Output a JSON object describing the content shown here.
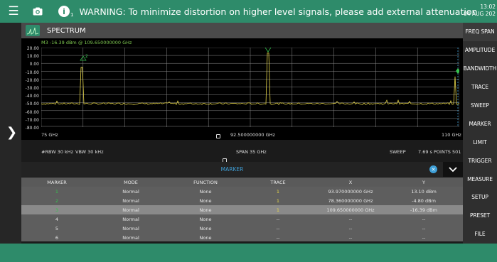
{
  "topbar": {
    "warning": "WARNING: To minimize distortion on higher level signals, please add external attenuation",
    "info_subscript": "1",
    "time": "13:02",
    "date": "04 AUG 202"
  },
  "header": {
    "title": "SPECTRUM"
  },
  "marker_readout": "M3  -16.39 dBm @ 109.650000000 GHz",
  "y_axis": [
    "20.00",
    "10.00",
    "0.00",
    "-10.00",
    "-20.00",
    "-30.00",
    "-40.00",
    "-50.00",
    "-60.00",
    "-70.00",
    "-80.00"
  ],
  "freq": {
    "start": "75 GHz",
    "center": "92.500000000 GHz",
    "stop": "110 GHz"
  },
  "params": {
    "rbw": "#RBW 30 kHz",
    "vbw": "VBW 30 kHz",
    "span": "SPAN 35 GHz",
    "sweep": "SWEEP",
    "sweep_time": "7.69 s",
    "points": "POINTS 501"
  },
  "marker_panel": {
    "title": "MARKER",
    "columns": [
      "MARKER",
      "MODE",
      "FUNCTION",
      "TRACE",
      "X",
      "Y"
    ],
    "rows": [
      {
        "marker": "1",
        "mode": "Normal",
        "function": "None",
        "trace": "1",
        "x": "93.970000000 GHz",
        "y": "13.10 dBm"
      },
      {
        "marker": "2",
        "mode": "Normal",
        "function": "None",
        "trace": "1",
        "x": "78.360000000 GHz",
        "y": "-4.80 dBm"
      },
      {
        "marker": "3",
        "mode": "Normal",
        "function": "None",
        "trace": "1",
        "x": "109.650000000 GHz",
        "y": "-16.39 dBm"
      },
      {
        "marker": "4",
        "mode": "Normal",
        "function": "None",
        "trace": "--",
        "x": "--",
        "y": "--"
      },
      {
        "marker": "5",
        "mode": "Normal",
        "function": "None",
        "trace": "--",
        "x": "--",
        "y": "--"
      },
      {
        "marker": "6",
        "mode": "Normal",
        "function": "None",
        "trace": "--",
        "x": "--",
        "y": "--"
      }
    ]
  },
  "right_menu": [
    "FREQ SPAN",
    "AMPLITUDE",
    "BANDWIDTH",
    "TRACE",
    "SWEEP",
    "MARKER",
    "LIMIT",
    "TRIGGER",
    "MEASURE",
    "SETUP",
    "PRESET",
    "FILE"
  ],
  "colors": {
    "accent": "#2e8b6a",
    "trace": "#e8d84a",
    "marker_active": "#36c24f",
    "marker_panel_title": "#3fa0d8"
  },
  "icons": {
    "menu": "hamburger-icon",
    "camera": "camera-icon",
    "info": "info-icon",
    "expand": "chevron-right-icon",
    "close": "close-circle-icon",
    "collapse": "chevron-down-icon"
  }
}
